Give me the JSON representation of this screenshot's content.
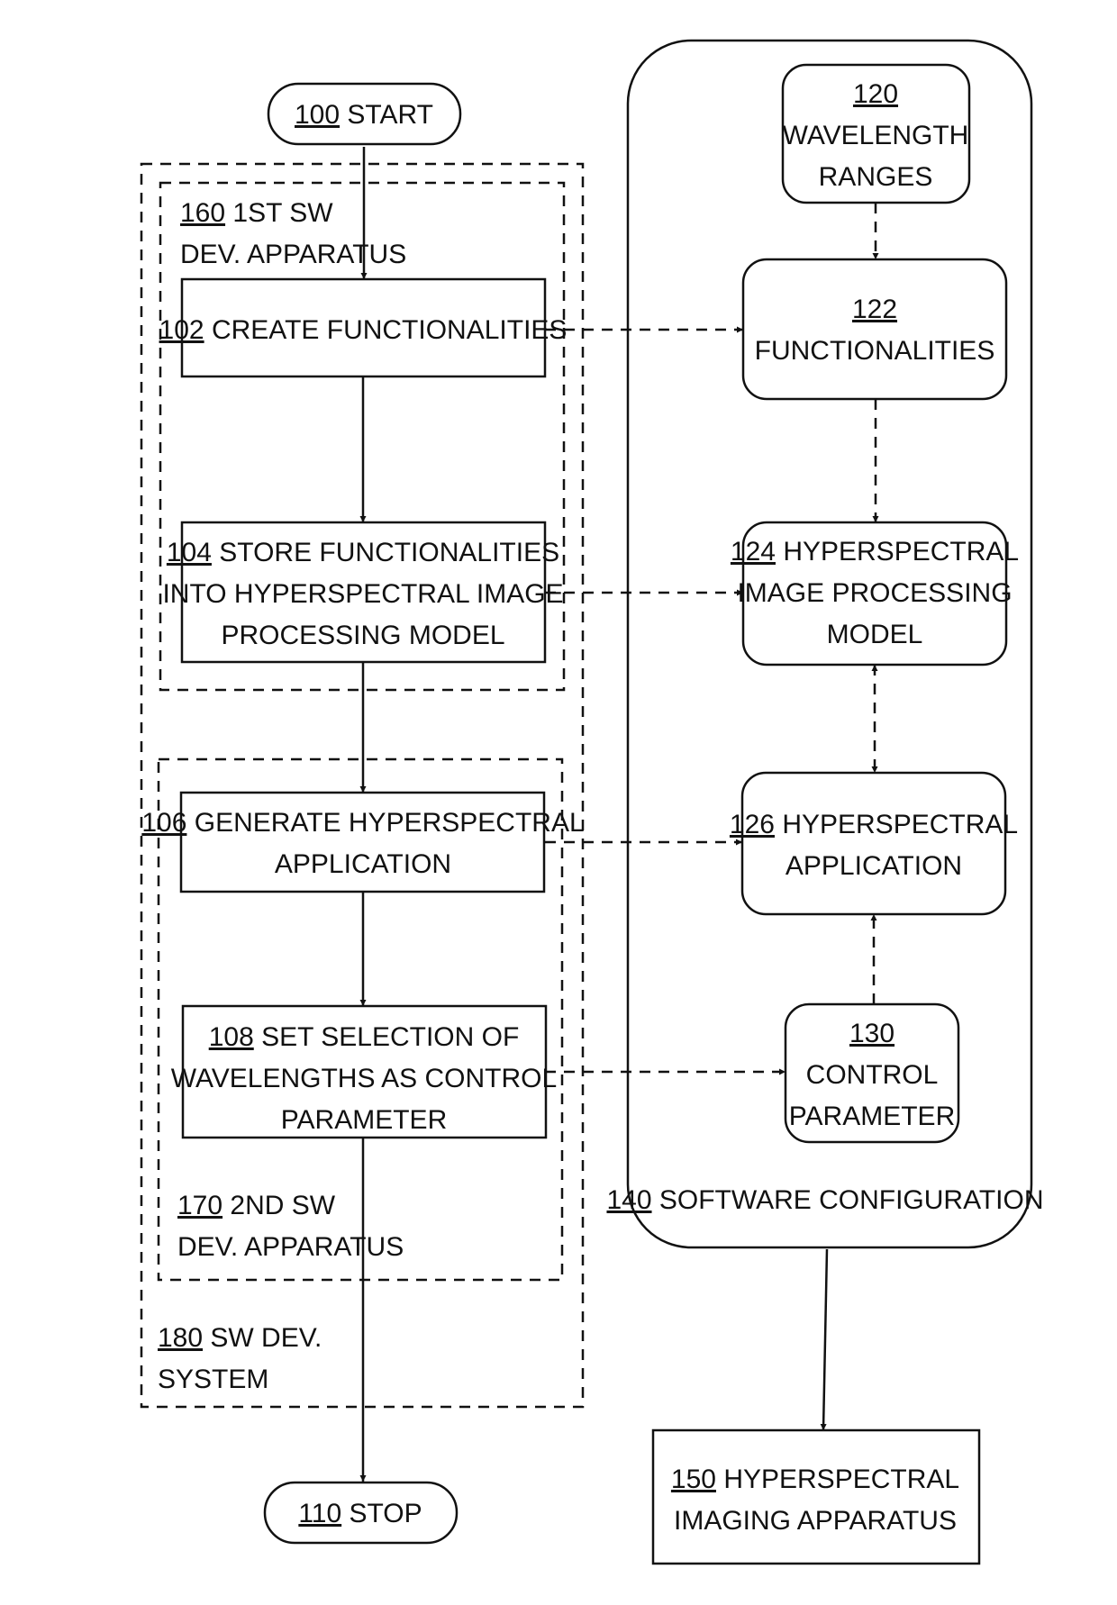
{
  "diagram": {
    "start": {
      "ref": "100",
      "label": "START"
    },
    "stop": {
      "ref": "110",
      "label": "STOP"
    },
    "steps": [
      {
        "ref": "102",
        "lines": [
          "CREATE FUNCTIONALITIES"
        ]
      },
      {
        "ref": "104",
        "lines": [
          "STORE FUNCTIONALITIES",
          "INTO HYPERSPECTRAL IMAGE",
          "PROCESSING MODEL"
        ]
      },
      {
        "ref": "106",
        "lines": [
          "GENERATE HYPERSPECTRAL",
          "APPLICATION"
        ]
      },
      {
        "ref": "108",
        "lines": [
          "SET SELECTION OF",
          "WAVELENGTHS AS CONTROL",
          "PARAMETER"
        ]
      }
    ],
    "groups": [
      {
        "ref": "160",
        "lines": [
          "1ST SW",
          "DEV. APPARATUS"
        ]
      },
      {
        "ref": "170",
        "lines": [
          "2ND SW",
          "DEV. APPARATUS"
        ]
      },
      {
        "ref": "180",
        "lines": [
          "SW DEV.",
          "SYSTEM"
        ]
      }
    ],
    "config": {
      "ref": "140",
      "label": "SOFTWARE CONFIGURATION",
      "items": [
        {
          "ref": "120",
          "lines": [
            "WAVELENGTH",
            "RANGES"
          ]
        },
        {
          "ref": "122",
          "lines": [
            "FUNCTIONALITIES"
          ]
        },
        {
          "ref": "124",
          "lines": [
            "HYPERSPECTRAL",
            "IMAGE PROCESSING",
            "MODEL"
          ]
        },
        {
          "ref": "126",
          "lines": [
            "HYPERSPECTRAL",
            "APPLICATION"
          ]
        },
        {
          "ref": "130",
          "lines": [
            "CONTROL",
            "PARAMETER"
          ]
        }
      ]
    },
    "apparatus": {
      "ref": "150",
      "lines": [
        "HYPERSPECTRAL",
        "IMAGING APPARATUS"
      ]
    }
  }
}
